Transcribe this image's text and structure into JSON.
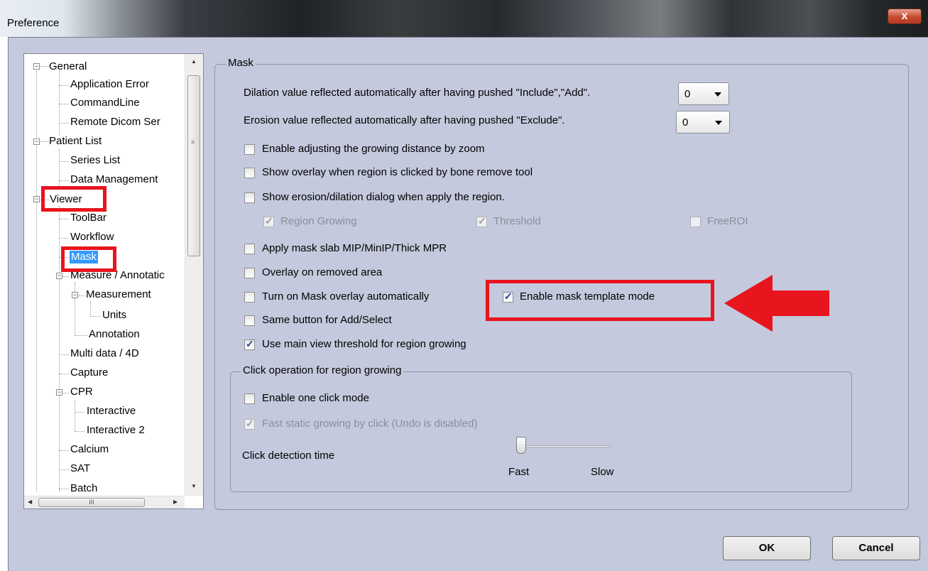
{
  "window": {
    "title": "Preference",
    "close_glyph": "x"
  },
  "tree": {
    "items": [
      {
        "label": "General"
      },
      {
        "label": "Application Error"
      },
      {
        "label": "CommandLine"
      },
      {
        "label": "Remote Dicom Ser"
      },
      {
        "label": "Patient List"
      },
      {
        "label": "Series List"
      },
      {
        "label": "Data Management"
      },
      {
        "label": "Viewer"
      },
      {
        "label": "ToolBar"
      },
      {
        "label": "Workflow"
      },
      {
        "label": "Mask"
      },
      {
        "label": "Measure / Annotatic"
      },
      {
        "label": "Measurement"
      },
      {
        "label": "Units"
      },
      {
        "label": "Annotation"
      },
      {
        "label": "Multi data / 4D"
      },
      {
        "label": "Capture"
      },
      {
        "label": "CPR"
      },
      {
        "label": "Interactive"
      },
      {
        "label": "Interactive 2"
      },
      {
        "label": "Calcium"
      },
      {
        "label": "SAT"
      },
      {
        "label": "Batch"
      }
    ],
    "selected": "Mask",
    "hscroll_grip": "III"
  },
  "mask": {
    "legend": "Mask",
    "dilation_label": "Dilation value reflected automatically after having pushed \"Include\",\"Add\".",
    "dilation_value": "0",
    "erosion_label": "Erosion value reflected automatically after having pushed \"Exclude\".",
    "erosion_value": "0",
    "options": [
      {
        "label": "Enable adjusting the growing distance by zoom",
        "checked": false
      },
      {
        "label": "Show overlay when region is clicked by bone remove tool",
        "checked": false
      },
      {
        "label": "Show erosion/dilation dialog when apply the region.",
        "checked": false
      },
      {
        "label": "Apply mask slab MIP/MinIP/Thick MPR",
        "checked": false
      },
      {
        "label": "Overlay on removed area",
        "checked": false
      },
      {
        "label": "Turn on Mask overlay automatically",
        "checked": false
      },
      {
        "label": "Same button for Add/Select",
        "checked": false
      },
      {
        "label": "Use main view threshold for region growing",
        "checked": true
      }
    ],
    "sub_options": [
      {
        "label": "Region Growing",
        "checked": true,
        "disabled": true
      },
      {
        "label": "Threshold",
        "checked": true,
        "disabled": true
      },
      {
        "label": "FreeROI",
        "checked": false,
        "disabled": true
      }
    ],
    "template_mode": {
      "label": "Enable mask template mode",
      "checked": true
    }
  },
  "click_op": {
    "legend": "Click operation for region growing",
    "one_click": {
      "label": "Enable one click mode",
      "checked": false
    },
    "fast_static": {
      "label": "Fast static growing by click (Undo is disabled)",
      "checked": true,
      "disabled": true
    },
    "detection_label": "Click detection time",
    "fast_label": "Fast",
    "slow_label": "Slow",
    "slider_level": 0
  },
  "buttons": {
    "ok": "OK",
    "cancel": "Cancel"
  },
  "colors": {
    "highlight": "#e8141e",
    "dialog_bg": "#c4c9dd",
    "selection": "#3399ff"
  }
}
